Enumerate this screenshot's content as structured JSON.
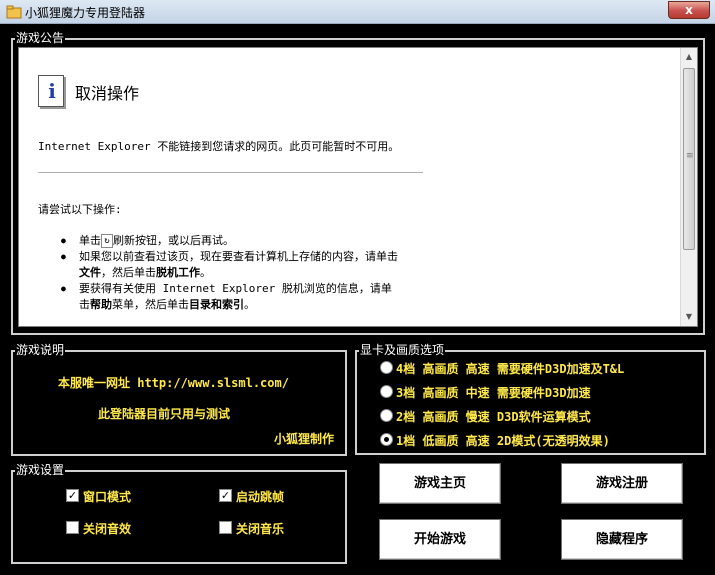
{
  "window": {
    "title": "小狐狸魔力专用登陆器",
    "close_label": "x",
    "icon": "app-icon"
  },
  "announcement": {
    "label": "游戏公告",
    "page": {
      "icon": "info-icon",
      "icon_glyph": "i",
      "title": "取消操作",
      "message": "Internet Explorer 不能链接到您请求的网页。此页可能暂时不可用。",
      "try_text": "请尝试以下操作:",
      "items": [
        {
          "pre": "单击",
          "post": "刷新按钮，或以后再试。"
        },
        {
          "pre": "如果您以前查看过该页，现在要查看计算机上存储的内容，请单击",
          "bold1": "文件",
          "mid": "，然后单击",
          "bold2": "脱机工作",
          "post": "。"
        },
        {
          "pre": "要获得有关使用 Internet Explorer 脱机浏览的信息，请单击",
          "bold1": "帮助",
          "mid": "菜单，然后单击",
          "bold2": "目录和索引",
          "post": "。"
        }
      ]
    }
  },
  "description": {
    "label": "游戏说明",
    "line1": "本服唯一网址 http://www.slsml.com/",
    "line2": "此登陆器目前只用与测试",
    "line3": "小狐狸制作"
  },
  "graphics": {
    "label": "显卡及画质选项",
    "selected_index": 3,
    "options": [
      "4档 高画质 高速 需要硬件D3D加速及T&L",
      "3档 高画质 中速 需要硬件D3D加速",
      "2档 高画质 慢速 D3D软件运算模式",
      "1档 低画质 高速 2D模式(无透明效果)"
    ]
  },
  "settings": {
    "label": "游戏设置",
    "options": [
      {
        "label": "窗口模式",
        "checked": true
      },
      {
        "label": "启动跳帧",
        "checked": true
      },
      {
        "label": "关闭音效",
        "checked": false
      },
      {
        "label": "关闭音乐",
        "checked": false
      }
    ]
  },
  "buttons": {
    "home": "游戏主页",
    "register": "游戏注册",
    "start": "开始游戏",
    "hide": "隐藏程序"
  },
  "colors": {
    "accent_text": "#ffe84a",
    "background": "#000000"
  }
}
